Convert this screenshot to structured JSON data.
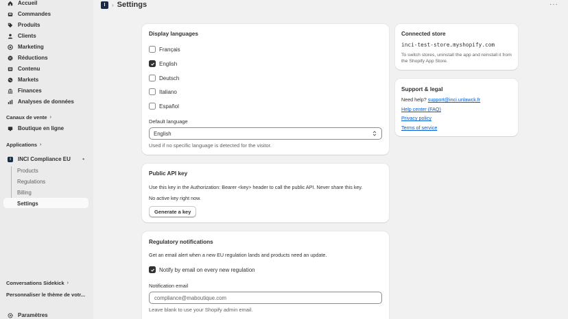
{
  "sidebar": {
    "items": [
      {
        "label": "Accueil",
        "icon": "home-icon"
      },
      {
        "label": "Commandes",
        "icon": "inbox-icon"
      },
      {
        "label": "Produits",
        "icon": "tag-icon"
      },
      {
        "label": "Clients",
        "icon": "person-icon"
      },
      {
        "label": "Marketing",
        "icon": "target-icon"
      },
      {
        "label": "Réductions",
        "icon": "discount-icon"
      },
      {
        "label": "Contenu",
        "icon": "content-icon"
      },
      {
        "label": "Markets",
        "icon": "globe-icon"
      },
      {
        "label": "Finances",
        "icon": "bank-icon"
      },
      {
        "label": "Analyses de données",
        "icon": "chart-icon"
      }
    ],
    "sales_channels": {
      "label": "Canaux de vente",
      "items": [
        {
          "label": "Boutique en ligne",
          "icon": "store-icon"
        }
      ]
    },
    "applications": {
      "label": "Applications",
      "app": {
        "label": "INCI Compliance EU",
        "pin": "•"
      },
      "sub_items": [
        "Products",
        "Regulations",
        "Billing",
        "Settings"
      ]
    },
    "sidekick": "Conversations Sidekick",
    "customize": "Personnaliser le thème de votr...",
    "settings": "Paramètres"
  },
  "header": {
    "logo": "I",
    "title": "Settings",
    "more": "···"
  },
  "display_languages": {
    "title": "Display languages",
    "options": [
      {
        "label": "Français",
        "checked": false
      },
      {
        "label": "English",
        "checked": true
      },
      {
        "label": "Deutsch",
        "checked": false
      },
      {
        "label": "Italiano",
        "checked": false
      },
      {
        "label": "Español",
        "checked": false
      }
    ],
    "default_label": "Default language",
    "default_value": "English",
    "help": "Used if no specific language is detected for the visitor."
  },
  "api_key": {
    "title": "Public API key",
    "description": "Use this key in the Authorization: Bearer <key> header to call the public API. Never share this key.",
    "status": "No active key right now.",
    "button": "Generate a key"
  },
  "notifications": {
    "title": "Regulatory notifications",
    "description": "Get an email alert when a new EU regulation lands and products need an update.",
    "notify_label": "Notify by email on every new regulation",
    "notify_checked": true,
    "email_label": "Notification email",
    "email_placeholder": "compliance@maboutique.com",
    "email_help": "Leave blank to use your Shopify admin email."
  },
  "connected_store": {
    "title": "Connected store",
    "domain": "inci-test-store.myshopify.com",
    "note": "To switch stores, uninstall the app and reinstall it from the Shopify App Store."
  },
  "support": {
    "title": "Support & legal",
    "need_help": "Need help?",
    "email": "support@inci.unlawck.fr",
    "links": [
      "Help center (FAQ)",
      "Privacy policy",
      "Terms of service"
    ]
  }
}
